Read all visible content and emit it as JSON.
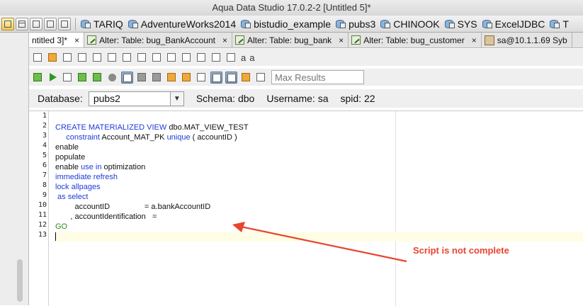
{
  "window": {
    "title": "Aqua Data Studio 17.0.2-2 [Untitled 5]*"
  },
  "connections": [
    {
      "name": "TARIQ"
    },
    {
      "name": "AdventureWorks2014"
    },
    {
      "name": "bistudio_example"
    },
    {
      "name": "pubs3"
    },
    {
      "name": "CHINOOK"
    },
    {
      "name": "SYS"
    },
    {
      "name": "ExcelJDBC"
    },
    {
      "name": "T"
    }
  ],
  "tabs": [
    {
      "label": "ntitled 3]*",
      "close": "×"
    },
    {
      "label": "Alter: Table: bug_BankAccount",
      "close": "×"
    },
    {
      "label": "Alter: Table: bug_bank",
      "close": "×"
    },
    {
      "label": "Alter: Table: bug_customer",
      "close": "×"
    },
    {
      "label": "sa@10.1.1.69 Syb"
    }
  ],
  "toolbar": {
    "font_a_label": "a",
    "font_a2_label": "a",
    "max_results_placeholder": "Max Results"
  },
  "dbbar": {
    "database_label": "Database:",
    "database_value": "pubs2",
    "schema_label": "Schema:",
    "schema_value": "dbo",
    "username_label": "Username:",
    "username_value": "sa",
    "spid_label": "spid:",
    "spid_value": "22"
  },
  "editor": {
    "line_numbers": [
      "1",
      "2",
      "3",
      "4",
      "5",
      "6",
      "7",
      "8",
      "9",
      "10",
      "11",
      "12",
      "13"
    ],
    "lines": [
      [],
      [
        {
          "t": "CREATE MATERIALIZED VIEW",
          "k": "kw"
        },
        {
          "t": " dbo.MAT_VIEW_TEST",
          "k": ""
        }
      ],
      [
        {
          "t": "     constraint",
          "k": "kw"
        },
        {
          "t": " Account_MAT_PK ",
          "k": ""
        },
        {
          "t": "unique",
          "k": "kw"
        },
        {
          "t": " ( accountID )",
          "k": ""
        }
      ],
      [
        {
          "t": "enable",
          "k": ""
        }
      ],
      [
        {
          "t": "populate",
          "k": ""
        }
      ],
      [
        {
          "t": "enable ",
          "k": ""
        },
        {
          "t": "use",
          "k": "kw"
        },
        {
          "t": " ",
          "k": ""
        },
        {
          "t": "in",
          "k": "kw"
        },
        {
          "t": " optimization",
          "k": ""
        }
      ],
      [
        {
          "t": "immediate refresh",
          "k": "kw"
        }
      ],
      [
        {
          "t": "lock allpages",
          "k": "kw"
        }
      ],
      [
        {
          "t": " as select",
          "k": "kw"
        }
      ],
      [
        {
          "t": "         accountID                = a.bankAccountID",
          "k": ""
        }
      ],
      [
        {
          "t": "       , accountIdentification   =",
          "k": ""
        }
      ],
      [
        {
          "t": "GO",
          "k": "go"
        }
      ],
      []
    ]
  },
  "annotation": {
    "text": "Script is not complete",
    "color": "#e8452e"
  }
}
